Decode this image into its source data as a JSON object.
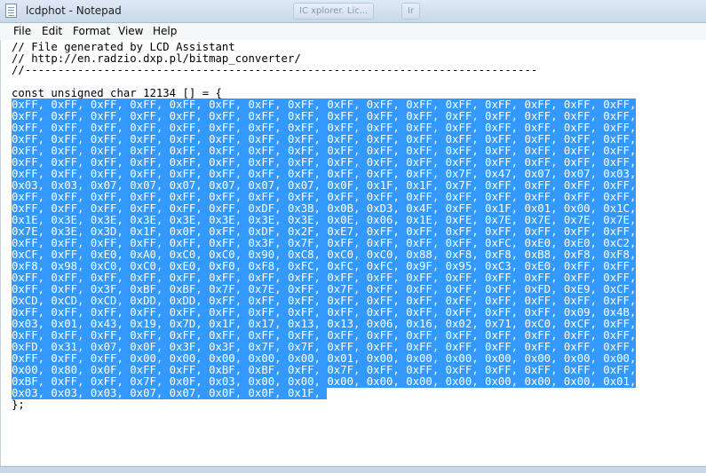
{
  "window": {
    "title": "lcdphot - Notepad",
    "ghost_tabs": [
      "IC xplorer. Lic...",
      "Ir"
    ]
  },
  "menu": [
    "File",
    "Edit",
    "Format",
    "View",
    "Help"
  ],
  "editor": {
    "pre_lines": [
      "// File generated by LCD Assistant",
      "// http://en.radzio.dxp.pl/bitmap_converter/",
      "//------------------------------------------------------------------------------",
      "",
      "const unsigned char 12134 [] = {"
    ],
    "selected_lines": [
      "0xFF, 0xFF, 0xFF, 0xFF, 0xFF, 0xFF, 0xFF, 0xFF, 0xFF, 0xFF, 0xFF, 0xFF, 0xFF, 0xFF, 0xFF, 0xFF,",
      "0xFF, 0xFF, 0xFF, 0xFF, 0xFF, 0xFF, 0xFF, 0xFF, 0xFF, 0xFF, 0xFF, 0xFF, 0xFF, 0xFF, 0xFF, 0xFF,",
      "0xFF, 0xFF, 0xFF, 0xFF, 0xFF, 0xFF, 0xFF, 0xFF, 0xFF, 0xFF, 0xFF, 0xFF, 0xFF, 0xFF, 0xFF, 0xFF,",
      "0xFF, 0xFF, 0xFF, 0xFF, 0xFF, 0xFF, 0xFF, 0xFF, 0xFF, 0xFF, 0xFF, 0xFF, 0xFF, 0xFF, 0xFF, 0xFF,",
      "0xFF, 0xFF, 0xFF, 0xFF, 0xFF, 0xFF, 0xFF, 0xFF, 0xFF, 0xFF, 0xFF, 0xFF, 0xFF, 0xFF, 0xFF, 0xFF,",
      "0xFF, 0xFF, 0xFF, 0xFF, 0xFF, 0xFF, 0xFF, 0xFF, 0xFF, 0xFF, 0xFF, 0xFF, 0xFF, 0xFF, 0xFF, 0xFF,",
      "0xFF, 0xFF, 0xFF, 0xFF, 0xFF, 0xFF, 0xFF, 0xFF, 0xFF, 0xFF, 0xFF, 0x7F, 0x47, 0x07, 0x07, 0x03,",
      "0x03, 0x03, 0x07, 0x07, 0x07, 0x07, 0x07, 0x07, 0x0F, 0x1F, 0x1F, 0x7F, 0xFF, 0xFF, 0xFF, 0xFF,",
      "0xFF, 0xFF, 0xFF, 0xFF, 0xFF, 0xFF, 0xFF, 0xFF, 0xFF, 0xFF, 0xFF, 0xFF, 0xFF, 0xFF, 0xFF, 0xFF,",
      "0xFF, 0xFF, 0xFF, 0xFF, 0xFF, 0xFF, 0xDF, 0x3B, 0x0B, 0xD3, 0x4F, 0xFF, 0x1F, 0x01, 0x00, 0x1C,",
      "0x1E, 0x3E, 0x3E, 0x3E, 0x3E, 0x3E, 0x3E, 0x3E, 0x0E, 0x06, 0x1E, 0xFE, 0x7E, 0x7E, 0x7E, 0x7E,",
      "0x7E, 0x3E, 0x3D, 0x1F, 0x0F, 0xFF, 0xDF, 0x2F, 0xE7, 0xFF, 0xFF, 0xFF, 0xFF, 0xFF, 0xFF, 0xFF,",
      "0xFF, 0xFF, 0xFF, 0xFF, 0xFF, 0xFF, 0x3F, 0x7F, 0xFF, 0xFF, 0xFF, 0xFF, 0xFC, 0xE0, 0xE0, 0xC2,",
      "0xCF, 0xFF, 0xE0, 0xA0, 0xC0, 0xC0, 0x90, 0xC8, 0xC0, 0xC0, 0x88, 0xF8, 0xF8, 0xB8, 0xF8, 0xF8,",
      "0xF8, 0x98, 0xC0, 0xC0, 0xE0, 0xF0, 0xF8, 0xFC, 0xFC, 0xFC, 0x9F, 0x95, 0xC3, 0xE0, 0xFF, 0xFF,",
      "0xFF, 0xFF, 0xFF, 0xFF, 0xFF, 0xFF, 0xFF, 0xFF, 0xFF, 0xFF, 0xFF, 0xFF, 0xFF, 0xFF, 0xFF, 0xFF,",
      "0xFF, 0xFF, 0x3F, 0xBF, 0xBF, 0x7F, 0x7E, 0xFF, 0x7F, 0xFF, 0xFF, 0xFF, 0xFF, 0xFD, 0xE9, 0xCF,",
      "0xCD, 0xCD, 0xCD, 0xDD, 0xDD, 0xFF, 0xFF, 0xFF, 0xFF, 0xFF, 0xFF, 0xFF, 0xFF, 0xFF, 0xFF, 0xFF,",
      "0xFF, 0xFF, 0xFF, 0xFF, 0xFF, 0xFF, 0xFF, 0xFF, 0xFF, 0xFF, 0xFF, 0xFF, 0xFF, 0xFF, 0x09, 0x4B,",
      "0x03, 0x01, 0x43, 0x19, 0x7D, 0x1F, 0x17, 0x13, 0x13, 0x06, 0x16, 0x02, 0x71, 0xC0, 0xCF, 0xFF,",
      "0xFF, 0xFF, 0xFF, 0xFF, 0xFF, 0xFF, 0xFF, 0xFF, 0xFF, 0xFF, 0xFF, 0xFF, 0xFF, 0xFF, 0xFF, 0xFF,",
      "0xFD, 0x31, 0x07, 0x0F, 0x3F, 0x3F, 0x7F, 0x7F, 0xFF, 0xFF, 0xFF, 0xFF, 0xFF, 0xFF, 0xFF, 0xFF,",
      "0xFF, 0xFF, 0xFF, 0x00, 0x00, 0x00, 0x00, 0x00, 0x01, 0x00, 0x00, 0x00, 0x00, 0x00, 0x00, 0x00,",
      "0x00, 0x80, 0x0F, 0xFF, 0xFF, 0xBF, 0xBF, 0xFF, 0x7F, 0xFF, 0xFF, 0xFF, 0xFF, 0xFF, 0xFF, 0xFF,",
      "0xBF, 0xFF, 0xFF, 0x7F, 0x0F, 0x03, 0x00, 0x00, 0x00, 0x00, 0x00, 0x00, 0x00, 0x00, 0x00, 0x01,",
      "0x03, 0x03, 0x03, 0x07, 0x07, 0x0F, 0x0F, 0x1F, "
    ],
    "post_lines": [
      "};"
    ]
  },
  "colors": {
    "selection": "#3399ff",
    "selection_text": "#ffffff"
  }
}
